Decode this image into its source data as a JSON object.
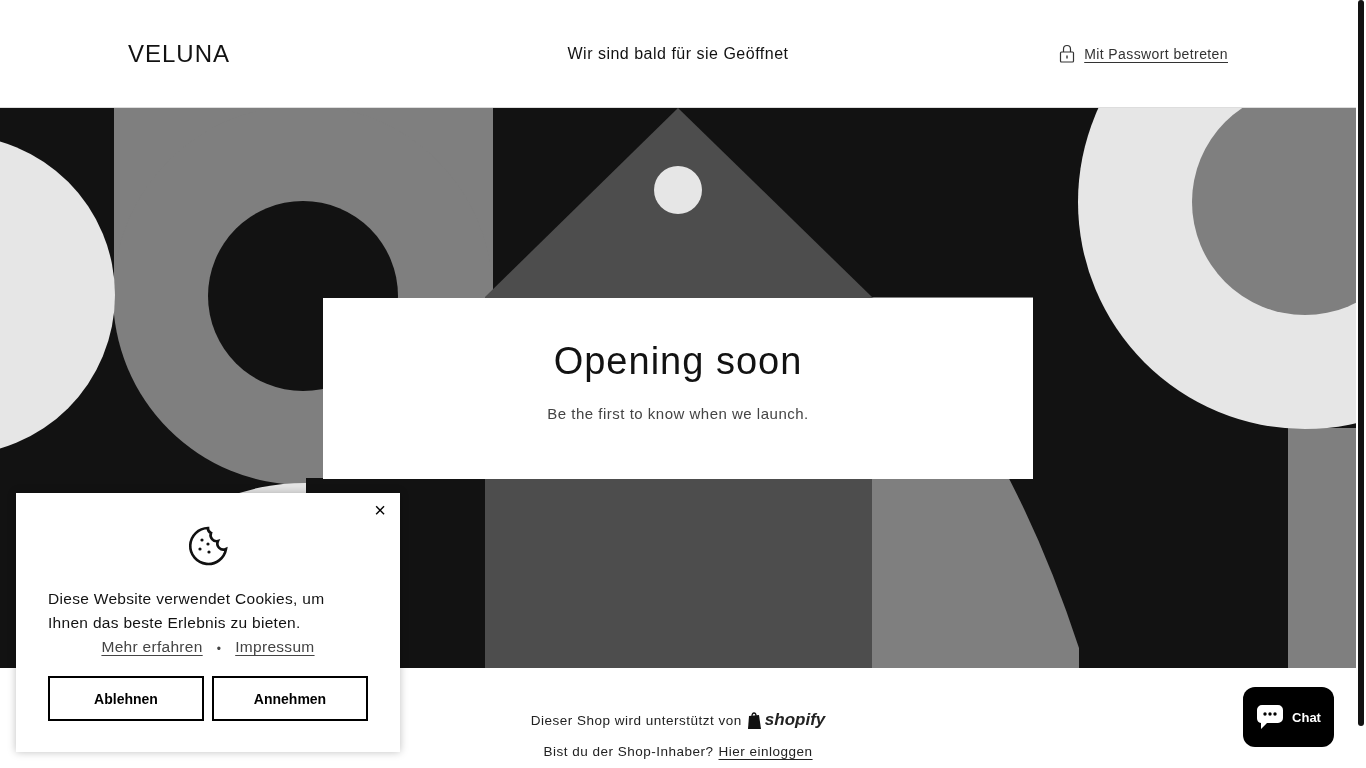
{
  "header": {
    "logo": "VELUNA",
    "announcement": "Wir sind bald für sie Geöffnet",
    "password_link": "Mit Passwort betreten"
  },
  "hero": {
    "title": "Opening soon",
    "subtitle": "Be the first to know when we launch."
  },
  "footer": {
    "powered_by": "Dieser Shop wird unterstützt von",
    "brand": "shopify",
    "owner_question": "Bist du der Shop-Inhaber?",
    "login_link": "Hier einloggen"
  },
  "cookie_banner": {
    "close": "×",
    "message": "Diese Website verwendet Cookies, um Ihnen das beste Erlebnis zu bieten.",
    "links": [
      "Mehr erfahren",
      "Impressum"
    ],
    "separator": "•",
    "buttons": [
      "Ablehnen",
      "Annehmen"
    ]
  },
  "chat_button": {
    "label": "Chat"
  }
}
